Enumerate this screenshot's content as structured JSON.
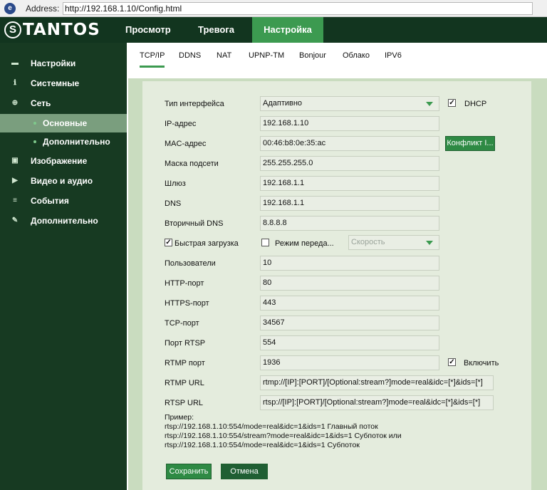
{
  "address": {
    "label": "Address:",
    "url": "http://192.168.1.10/Config.html",
    "icon": "ie-icon"
  },
  "header": {
    "brand": "TANTOS",
    "tabs": [
      {
        "label": "Просмотр"
      },
      {
        "label": "Тревога"
      },
      {
        "label": "Настройка",
        "active": true
      }
    ]
  },
  "sidebar": {
    "items": [
      {
        "label": "Настройки",
        "icon": "settings-icon"
      },
      {
        "label": "Системные",
        "icon": "info-icon"
      },
      {
        "label": "Сеть",
        "icon": "globe-icon"
      },
      {
        "label": "Основные",
        "active": true
      },
      {
        "label": "Дополнительно"
      },
      {
        "label": "Изображение",
        "icon": "image-icon"
      },
      {
        "label": "Видео и аудио",
        "icon": "video-icon"
      },
      {
        "label": "События",
        "icon": "event-icon"
      },
      {
        "label": "Дополнительно",
        "icon": "tools-icon"
      }
    ]
  },
  "subtabs": [
    "TCP/IP",
    "DDNS",
    "NAT",
    "UPNP-TM",
    "Bonjour",
    "Облако",
    "IPV6"
  ],
  "form": {
    "interface_type": {
      "label": "Тип интерфейса",
      "value": "Адаптивно"
    },
    "dhcp": {
      "label": "DHCP",
      "checked": true
    },
    "ip": {
      "label": "IP-адрес",
      "value": "192.168.1.10"
    },
    "mac": {
      "label": "MAC-адрес",
      "value": "00:46:b8:0e:35:ac"
    },
    "conflict_button": "Конфликт I...",
    "mask": {
      "label": "Маска подсети",
      "value": "255.255.255.0"
    },
    "gateway": {
      "label": "Шлюз",
      "value": "192.168.1.1"
    },
    "dns": {
      "label": "DNS",
      "value": "192.168.1.1"
    },
    "dns2": {
      "label": "Вторичный DNS",
      "value": "8.8.8.8"
    },
    "fast_load": {
      "label": "Быстрая загрузка",
      "checked": true
    },
    "transfer_mode": {
      "label": "Режим переда...",
      "checked": false
    },
    "speed": {
      "value": "Скорость"
    },
    "users": {
      "label": "Пользователи",
      "value": "10"
    },
    "http_port": {
      "label": "HTTP-порт",
      "value": "80"
    },
    "https_port": {
      "label": "HTTPS-порт",
      "value": "443"
    },
    "tcp_port": {
      "label": "TCP-порт",
      "value": "34567"
    },
    "rtsp_port": {
      "label": "Порт RTSP",
      "value": "554"
    },
    "rtmp_port": {
      "label": "RTMP порт",
      "value": "1936"
    },
    "rtmp_enable": {
      "label": "Включить",
      "checked": true
    },
    "rtmp_url": {
      "label": "RTMP URL",
      "value": "rtmp://[IP]:[PORT]/[Optional:stream?]mode=real&idc=[*]&ids=[*]"
    },
    "rtsp_url": {
      "label": "RTSP URL",
      "value": "rtsp://[IP]:[PORT]/[Optional:stream?]mode=real&idc=[*]&ids=[*]"
    },
    "example": {
      "title": "Пример:",
      "lines": [
        "rtsp://192.168.1.10:554/mode=real&idc=1&ids=1 Главный поток",
        "rtsp://192.168.1.10:554/stream?mode=real&idc=1&ids=1 Субпоток или",
        "rtsp://192.168.1.10:554/mode=real&idc=1&ids=1 Субпоток"
      ]
    },
    "save_button": "Сохранить",
    "cancel_button": "Отмена"
  },
  "colors": {
    "header": "#12351f",
    "sidebar": "#173a22",
    "accent": "#3c9a50",
    "panel": "#e4ecdd"
  }
}
